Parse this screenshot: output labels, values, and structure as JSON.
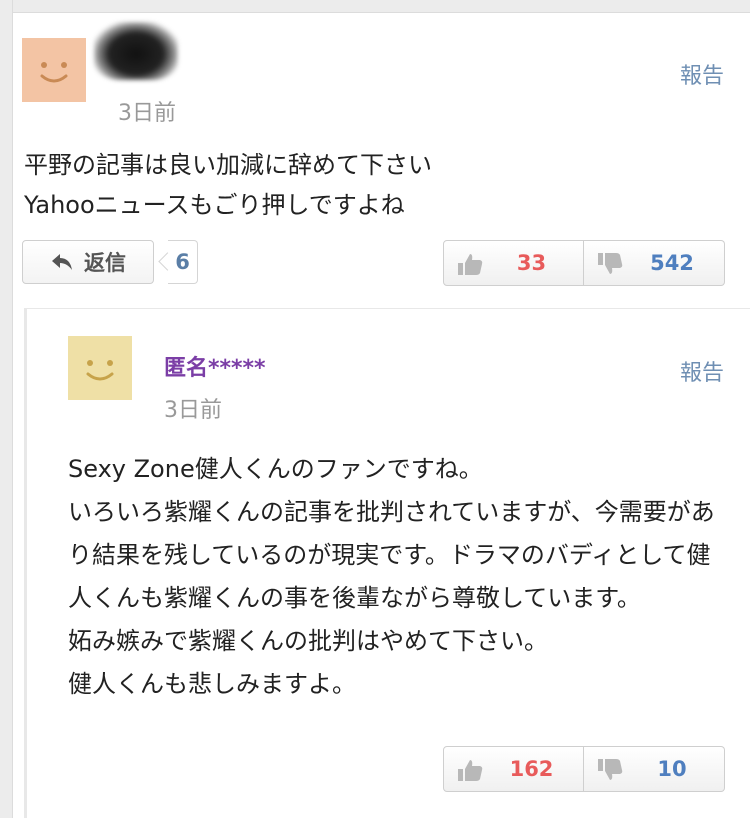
{
  "comment1": {
    "time": "3日前",
    "report_label": "報告",
    "text": "平野の記事は良い加減に辞めて下さい\nYahooニュースもごり押しですよね",
    "reply_label": "返信",
    "reply_count": "6",
    "upvotes": "33",
    "downvotes": "542",
    "avatar_color": "#f3c4a4"
  },
  "comment2": {
    "username": "匿名*****",
    "time": "3日前",
    "report_label": "報告",
    "text": "Sexy Zone健人くんのファンですね。\nいろいろ紫耀くんの記事を批判されていますが、今需要があり結果を残しているのが現実です。ドラマのバディとして健人くんも紫耀くんの事を後輩ながら尊敬しています。\n妬み嫉みで紫耀くんの批判はやめて下さい。\n健人くんも悲しみますよ。",
    "upvotes": "162",
    "downvotes": "10",
    "avatar_color": "#efe0a6"
  },
  "icons": {
    "avatar": "smiley-face-icon",
    "reply": "reply-arrow-icon",
    "upvote": "thumbs-up-icon",
    "downvote": "thumbs-down-icon"
  },
  "colors": {
    "upvote": "#e85b5b",
    "downvote": "#4f7fbf",
    "link": "#6f8fb3",
    "username": "#7b3ea6"
  }
}
